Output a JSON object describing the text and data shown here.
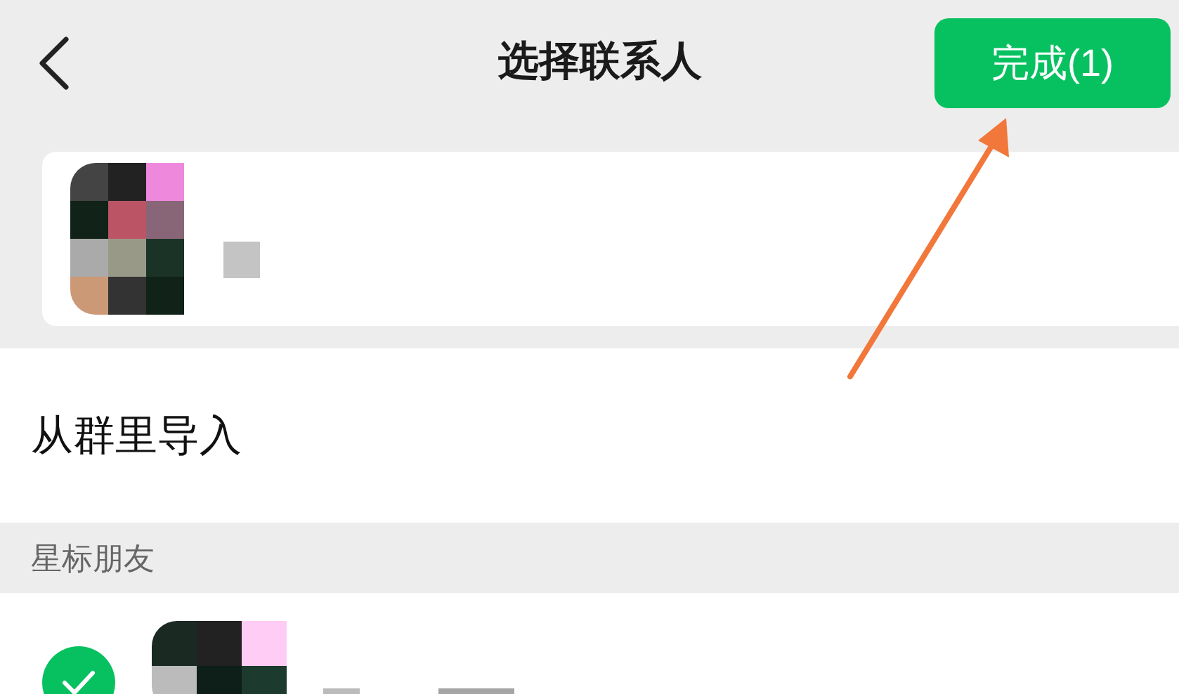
{
  "header": {
    "title": "选择联系人",
    "done_button": "完成(1)"
  },
  "import_row": {
    "label": "从群里导入"
  },
  "section": {
    "title": "星标朋友"
  },
  "contacts": [
    {
      "selected": true
    }
  ]
}
